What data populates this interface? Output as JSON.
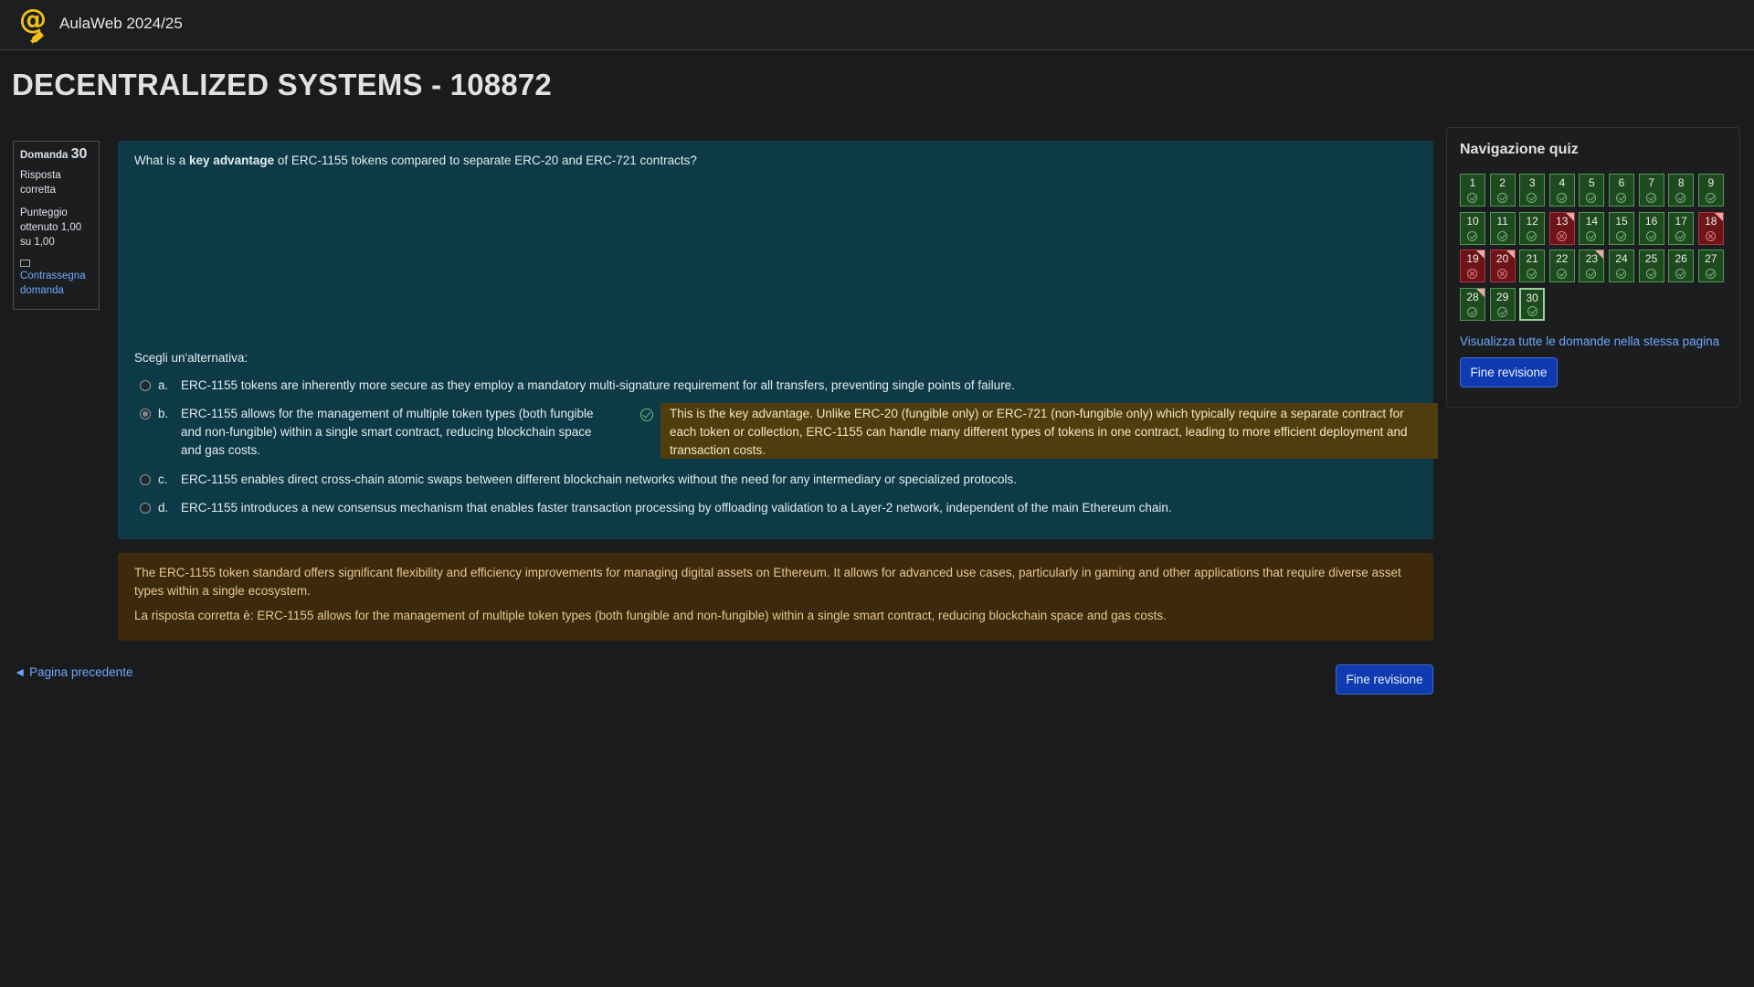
{
  "header": {
    "site_name": "AulaWeb 2024/25",
    "logo_icon": "aulaweb-at-logo"
  },
  "page": {
    "course_title": "DECENTRALIZED SYSTEMS - 108872"
  },
  "question_info": {
    "label": "Domanda",
    "number": "30",
    "state": "Risposta corretta",
    "grade": "Punteggio ottenuto 1,00 su 1,00",
    "flag_label": "Contrassegna domanda"
  },
  "question": {
    "text_before": "What is a ",
    "text_bold": "key advantage",
    "text_after": " of ERC-1155 tokens compared to separate ERC-20 and ERC-721 contracts?",
    "prompt": "Scegli un'alternativa:",
    "answers": [
      {
        "letter": "a.",
        "text": "ERC-1155 tokens are inherently more secure as they employ a mandatory multi-signature requirement for all transfers, preventing single points of failure.",
        "selected": false
      },
      {
        "letter": "b.",
        "text": "ERC-1155 allows for the management of multiple token types (both fungible and non-fungible) within a single smart contract, reducing blockchain space and gas costs.",
        "selected": true,
        "feedback": "This is the key advantage. Unlike ERC-20 (fungible only) or ERC-721 (non-fungible only) which typically require a separate contract for each token or collection, ERC-1155 can handle many different types of tokens in one contract, leading to more efficient deployment and transaction costs."
      },
      {
        "letter": "c.",
        "text": "ERC-1155 enables direct cross-chain atomic swaps between different blockchain networks without the need for any intermediary or specialized protocols.",
        "selected": false
      },
      {
        "letter": "d.",
        "text": "ERC-1155 introduces a new consensus mechanism that enables faster transaction processing by offloading validation to a Layer-2 network, independent of the main Ethereum chain.",
        "selected": false
      }
    ]
  },
  "outcome": {
    "general_feedback": "The ERC-1155 token standard offers significant flexibility and efficiency improvements for managing digital assets on Ethereum. It allows for advanced use cases, particularly in gaming and other applications that require diverse asset types within a single ecosystem.",
    "right_answer": "La risposta corretta è: ERC-1155 allows for the management of multiple token types (both fungible and non-fungible) within a single smart contract, reducing blockchain space and gas costs."
  },
  "footer": {
    "prev_link": "◄ Pagina precedente",
    "finish_button": "Fine revisione"
  },
  "quiz_nav": {
    "title": "Navigazione quiz",
    "questions": [
      {
        "n": "1",
        "state": "correct"
      },
      {
        "n": "2",
        "state": "correct"
      },
      {
        "n": "3",
        "state": "correct"
      },
      {
        "n": "4",
        "state": "correct"
      },
      {
        "n": "5",
        "state": "correct"
      },
      {
        "n": "6",
        "state": "correct"
      },
      {
        "n": "7",
        "state": "correct"
      },
      {
        "n": "8",
        "state": "correct"
      },
      {
        "n": "9",
        "state": "correct"
      },
      {
        "n": "10",
        "state": "correct"
      },
      {
        "n": "11",
        "state": "correct"
      },
      {
        "n": "12",
        "state": "correct"
      },
      {
        "n": "13",
        "state": "incorrect",
        "flagged": true
      },
      {
        "n": "14",
        "state": "correct"
      },
      {
        "n": "15",
        "state": "correct"
      },
      {
        "n": "16",
        "state": "correct"
      },
      {
        "n": "17",
        "state": "correct"
      },
      {
        "n": "18",
        "state": "incorrect",
        "flagged": true
      },
      {
        "n": "19",
        "state": "incorrect",
        "flagged": true
      },
      {
        "n": "20",
        "state": "incorrect",
        "flagged": true
      },
      {
        "n": "21",
        "state": "correct"
      },
      {
        "n": "22",
        "state": "correct"
      },
      {
        "n": "23",
        "state": "correct",
        "flagged": true
      },
      {
        "n": "24",
        "state": "correct"
      },
      {
        "n": "25",
        "state": "correct"
      },
      {
        "n": "26",
        "state": "correct"
      },
      {
        "n": "27",
        "state": "correct"
      },
      {
        "n": "28",
        "state": "correct",
        "flagged": true
      },
      {
        "n": "29",
        "state": "correct"
      },
      {
        "n": "30",
        "state": "correct",
        "current": true
      }
    ],
    "show_all_link": "Visualizza tutte le domande nella stessa pagina",
    "finish_button": "Fine revisione"
  }
}
